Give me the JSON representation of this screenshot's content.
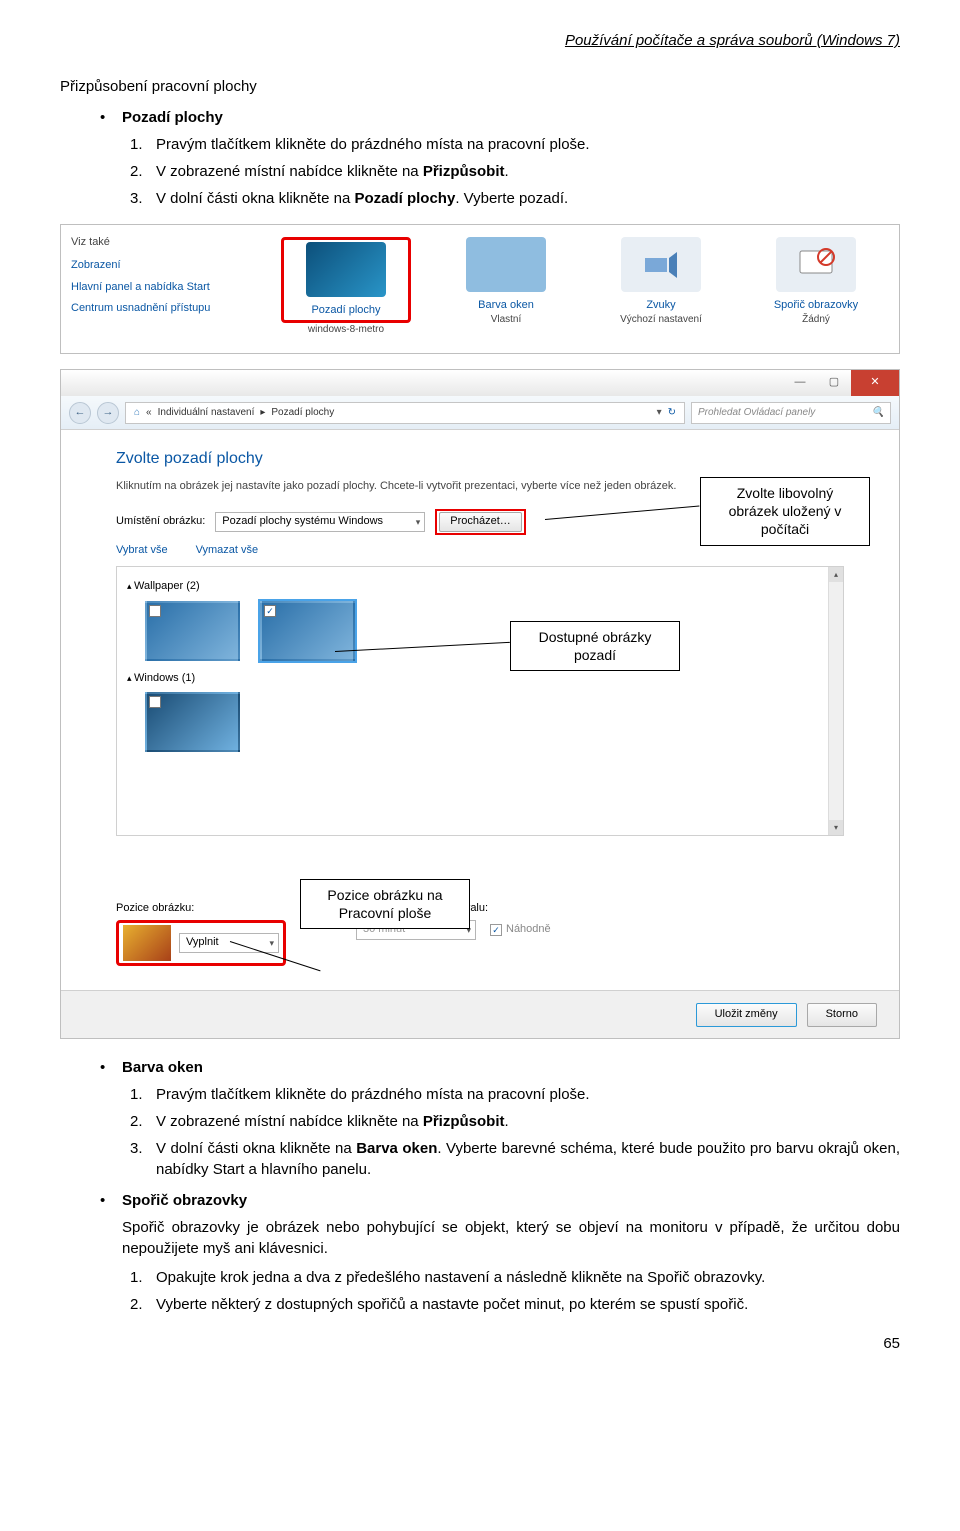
{
  "header": "Používání počítače a správa souborů (Windows 7)",
  "sectionTitle": "Přizpůsobení pracovní plochy",
  "bullet1": {
    "label": "Pozadí plochy",
    "steps": [
      {
        "n": "1.",
        "t": "Pravým tlačítkem klikněte do prázdného místa na pracovní ploše."
      },
      {
        "n": "2.",
        "pre": "V zobrazené místní nabídce klikněte na ",
        "bold": "Přizpůsobit",
        "post": "."
      },
      {
        "n": "3.",
        "pre": "V dolní části okna klikněte na ",
        "bold": "Pozadí plochy",
        "post": ". Vyberte pozadí."
      }
    ]
  },
  "shot1": {
    "side_hd": "Viz také",
    "side_links": [
      "Zobrazení",
      "Hlavní panel a nabídka Start",
      "Centrum usnadnění přístupu"
    ],
    "tiles": [
      {
        "t1": "Pozadí plochy",
        "t2": "windows-8-metro"
      },
      {
        "t1": "Barva oken",
        "t2": "Vlastní"
      },
      {
        "t1": "Zvuky",
        "t2": "Výchozí nastavení"
      },
      {
        "t1": "Spořič obrazovky",
        "t2": "Žádný"
      }
    ]
  },
  "shot2": {
    "crumb_parts": [
      "«",
      "Individuální nastavení",
      "▸",
      "Pozadí plochy"
    ],
    "search_ph": "Prohledat Ovládací panely",
    "h": "Zvolte pozadí plochy",
    "sub": "Kliknutím na obrázek jej nastavíte jako pozadí plochy. Chcete-li vytvořit prezentaci, vyberte více než jeden obrázek.",
    "loc_label": "Umístění obrázku:",
    "loc_dd": "Pozadí plochy systému Windows",
    "browse": "Procházet…",
    "selall": "Vybrat vše",
    "deselall": "Vymazat vše",
    "grp1": "Wallpaper (2)",
    "grp2": "Windows (1)",
    "pos_label": "Pozice obrázku:",
    "pos_val": "Vyplnit",
    "int_label": "Změnit obrázek v intervalu:",
    "int_val": "30 minut",
    "rnd": "Náhodně",
    "save": "Uložit změny",
    "cancel": "Storno"
  },
  "callouts": {
    "c1": "Zvolte libovolný obrázek uložený v počítači",
    "c2": "Dostupné obrázky pozadí",
    "c3": "Pozice obrázku na Pracovní ploše"
  },
  "bullet2": {
    "label": "Barva oken",
    "steps": [
      {
        "n": "1.",
        "t": "Pravým tlačítkem klikněte do prázdného místa na pracovní ploše."
      },
      {
        "n": "2.",
        "pre": "V zobrazené místní nabídce klikněte na ",
        "bold": "Přizpůsobit",
        "post": "."
      },
      {
        "n": "3.",
        "pre": "V dolní části okna klikněte na ",
        "bold": "Barva oken",
        "post": ". Vyberte barevné schéma, které bude použito pro barvu okrajů oken, nabídky Start a hlavního panelu."
      }
    ]
  },
  "bullet3": {
    "label": "Spořič obrazovky",
    "para": "Spořič obrazovky je obrázek nebo pohybující se objekt, který se objeví na monitoru v případě, že určitou dobu nepoužijete myš ani klávesnici.",
    "steps": [
      {
        "n": "1.",
        "t": "Opakujte krok jedna a dva z předešlého nastavení a následně klikněte na Spořič obrazovky."
      },
      {
        "n": "2.",
        "t": "Vyberte některý z dostupných spořičů a nastavte počet minut, po kterém se spustí spořič."
      }
    ]
  },
  "pagenum": "65"
}
